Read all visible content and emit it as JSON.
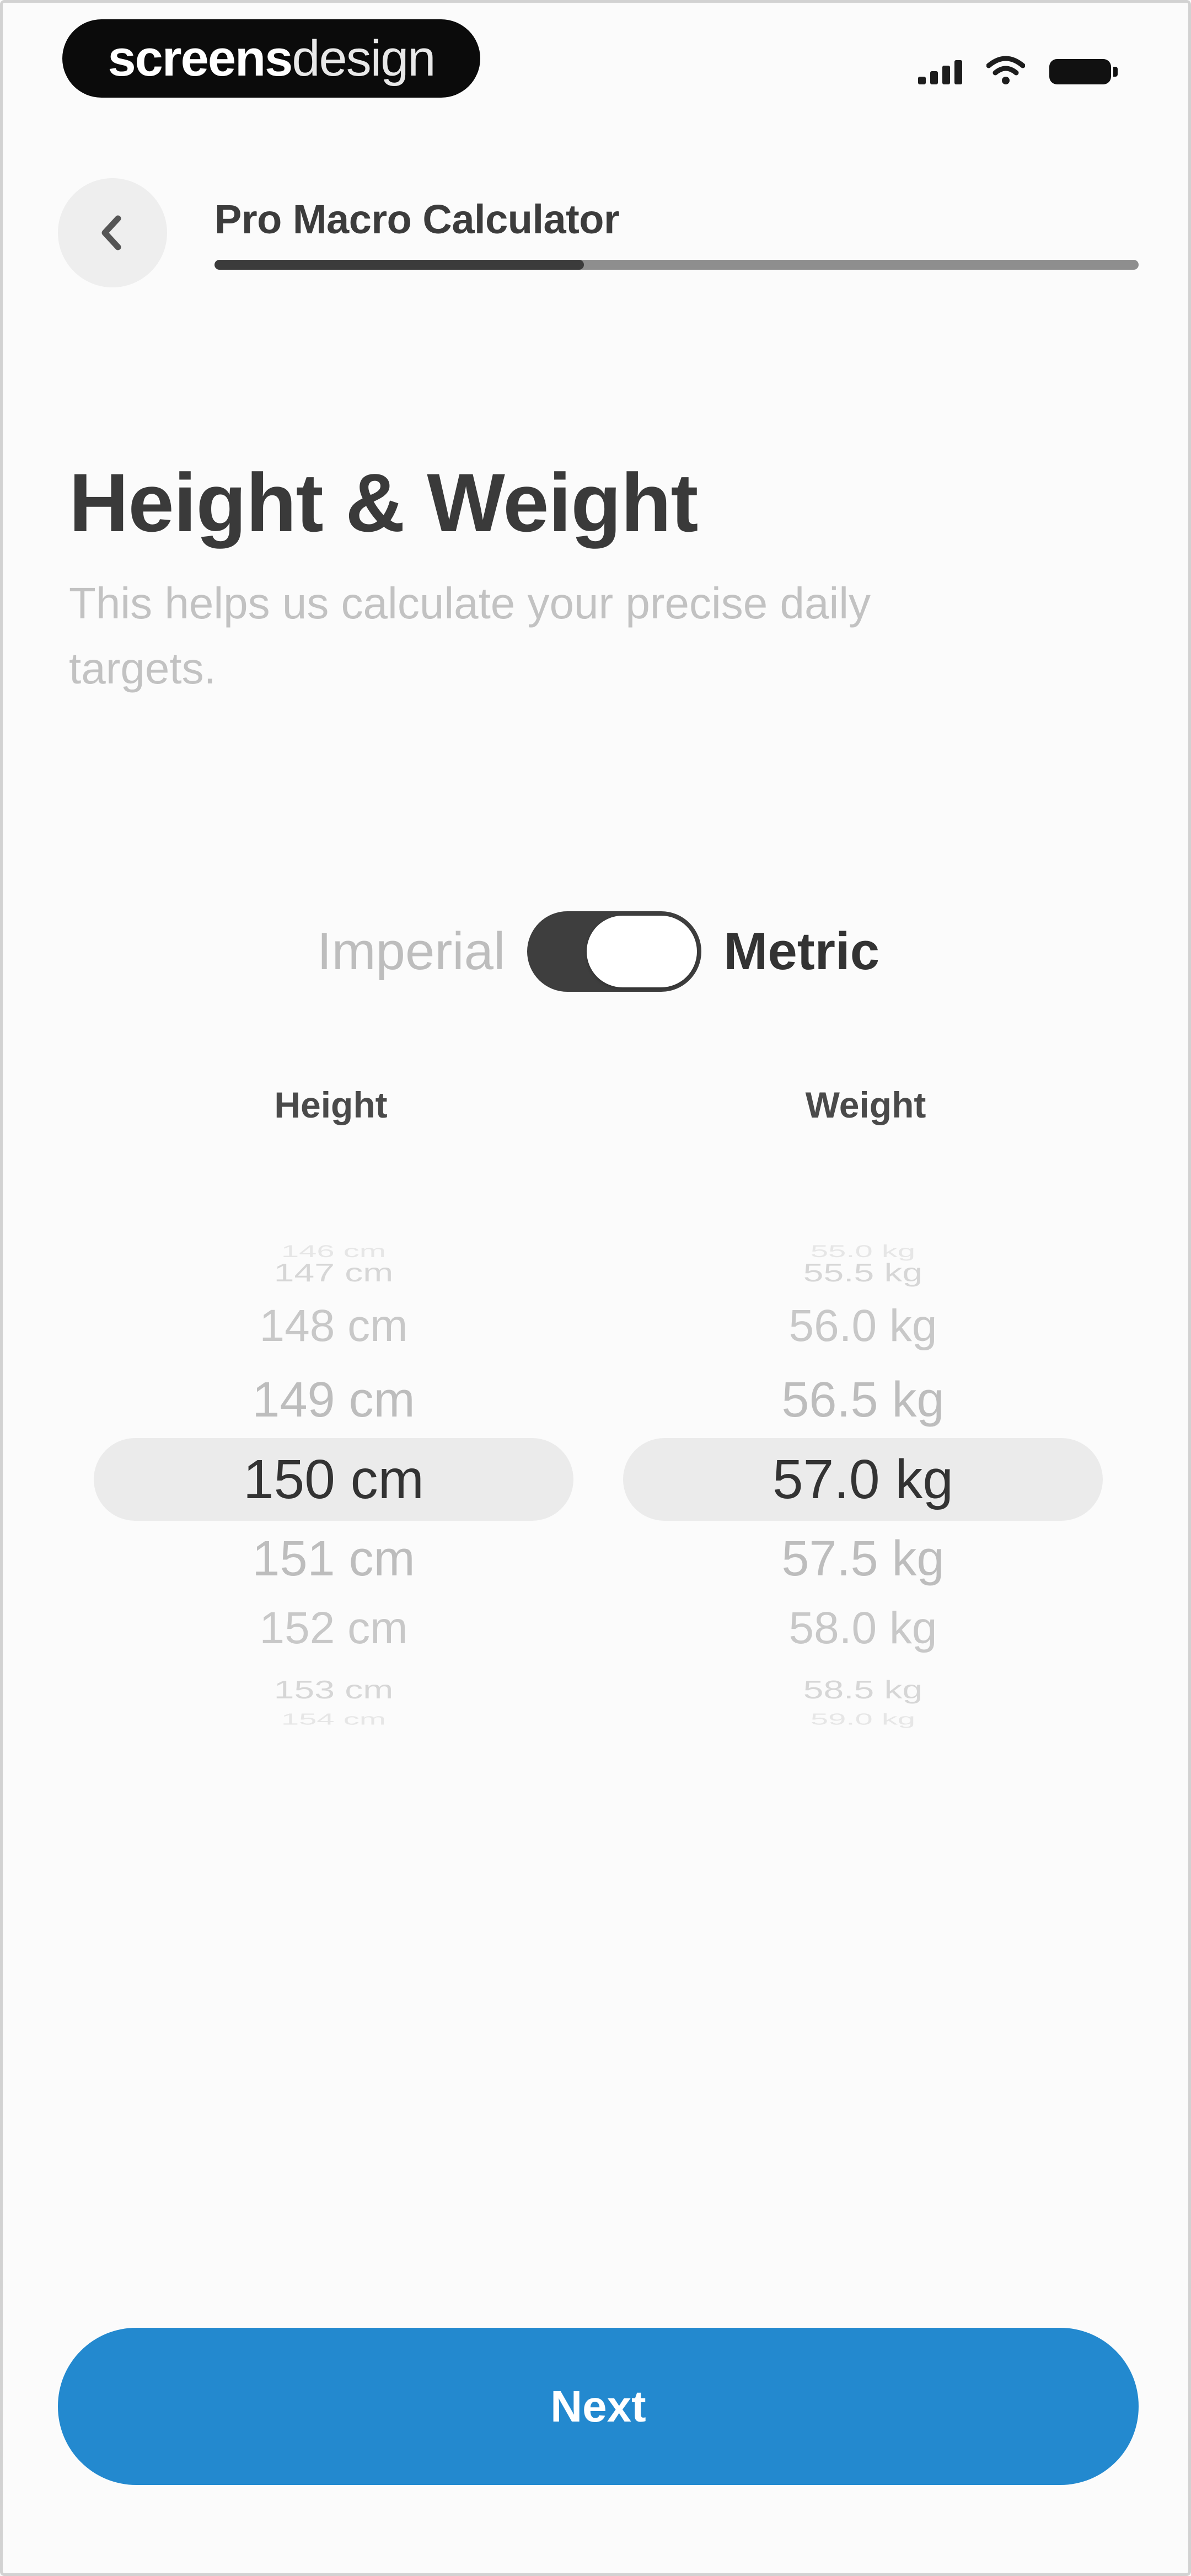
{
  "status_bar": {
    "brand_bold": "screens",
    "brand_light": "design",
    "icons": [
      "cellular-signal-icon",
      "wifi-icon",
      "battery-icon"
    ]
  },
  "header": {
    "back_icon": "chevron-left-icon",
    "title": "Pro Macro Calculator",
    "progress": 0.4
  },
  "page": {
    "title": "Height & Weight",
    "subtitle": "This helps us calculate your precise daily targets."
  },
  "units": {
    "left_label": "Imperial",
    "right_label": "Metric",
    "selected": "Metric"
  },
  "pickers": {
    "height": {
      "label": "Height",
      "items": [
        "146 cm",
        "147 cm",
        "148 cm",
        "149 cm",
        "150 cm",
        "151 cm",
        "152 cm",
        "153 cm",
        "154 cm"
      ],
      "selected": "150 cm"
    },
    "weight": {
      "label": "Weight",
      "items": [
        "55.0 kg",
        "55.5 kg",
        "56.0 kg",
        "56.5 kg",
        "57.0 kg",
        "57.5 kg",
        "58.0 kg",
        "58.5 kg",
        "59.0 kg"
      ],
      "selected": "57.0 kg"
    }
  },
  "footer": {
    "next_label": "Next"
  },
  "colors": {
    "accent": "#2389cf",
    "toggle_track": "#3e3e3e",
    "picker_highlight": "#ebebeb"
  }
}
